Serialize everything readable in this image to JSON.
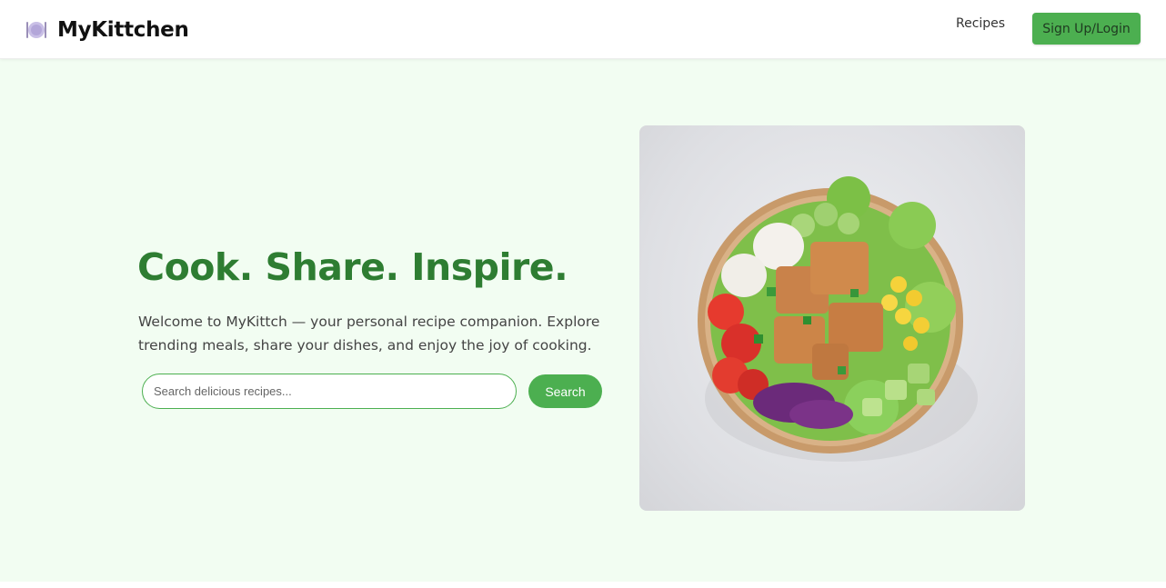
{
  "brand": {
    "name": "MyKittchen",
    "icon": "plate-icon"
  },
  "nav": {
    "recipes_label": "Recipes",
    "signup_label": "Sign Up/Login"
  },
  "hero": {
    "headline": "Cook. Share. Inspire.",
    "tagline": "Welcome to MyKittch — your personal recipe companion. Explore trending meals, share your dishes, and enjoy the joy of cooking.",
    "search": {
      "placeholder": "Search delicious recipes...",
      "value": "",
      "button_label": "Search"
    },
    "image": "salad-bowl-photo"
  },
  "colors": {
    "accent": "#4caf50",
    "headline": "#2e7d32",
    "hero_background": "#f2fdf2"
  }
}
